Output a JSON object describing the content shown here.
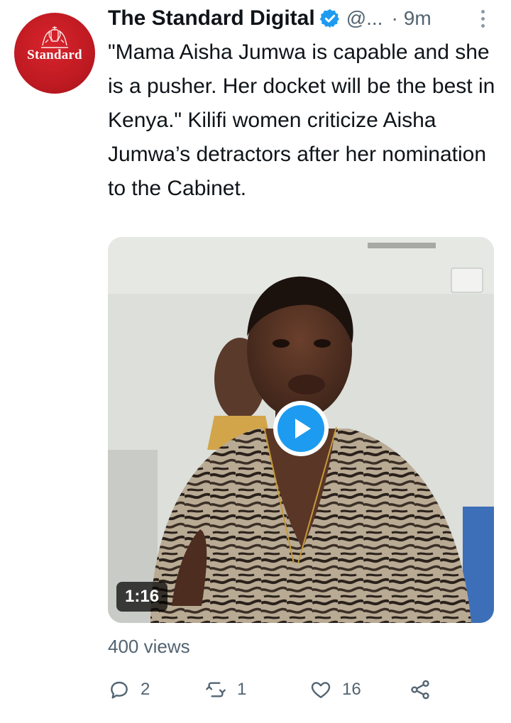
{
  "tweet": {
    "avatar": {
      "brand": "Standard",
      "icon": "standard-crest-logo",
      "color": "#c8202a"
    },
    "author": {
      "name": "The Standard Digital",
      "verified": true,
      "handle": "@...",
      "separator": "·",
      "time": "9m"
    },
    "more_icon": "more-vertical-icon",
    "text": "\"Mama Aisha Jumwa is capable and she is a pusher. Her docket will be the best in Kenya.\" Kilifi women criticize Aisha Jumwa’s detractors after her nomination to the Cabinet.",
    "media": {
      "type": "video",
      "duration": "1:16",
      "play_icon": "play-icon",
      "accent": "#1d9bf0"
    },
    "views": "400 views",
    "actions": {
      "reply": {
        "icon": "reply-icon",
        "count": "2"
      },
      "retweet": {
        "icon": "retweet-icon",
        "count": "1"
      },
      "like": {
        "icon": "like-icon",
        "count": "16"
      },
      "share": {
        "icon": "share-icon"
      }
    }
  }
}
